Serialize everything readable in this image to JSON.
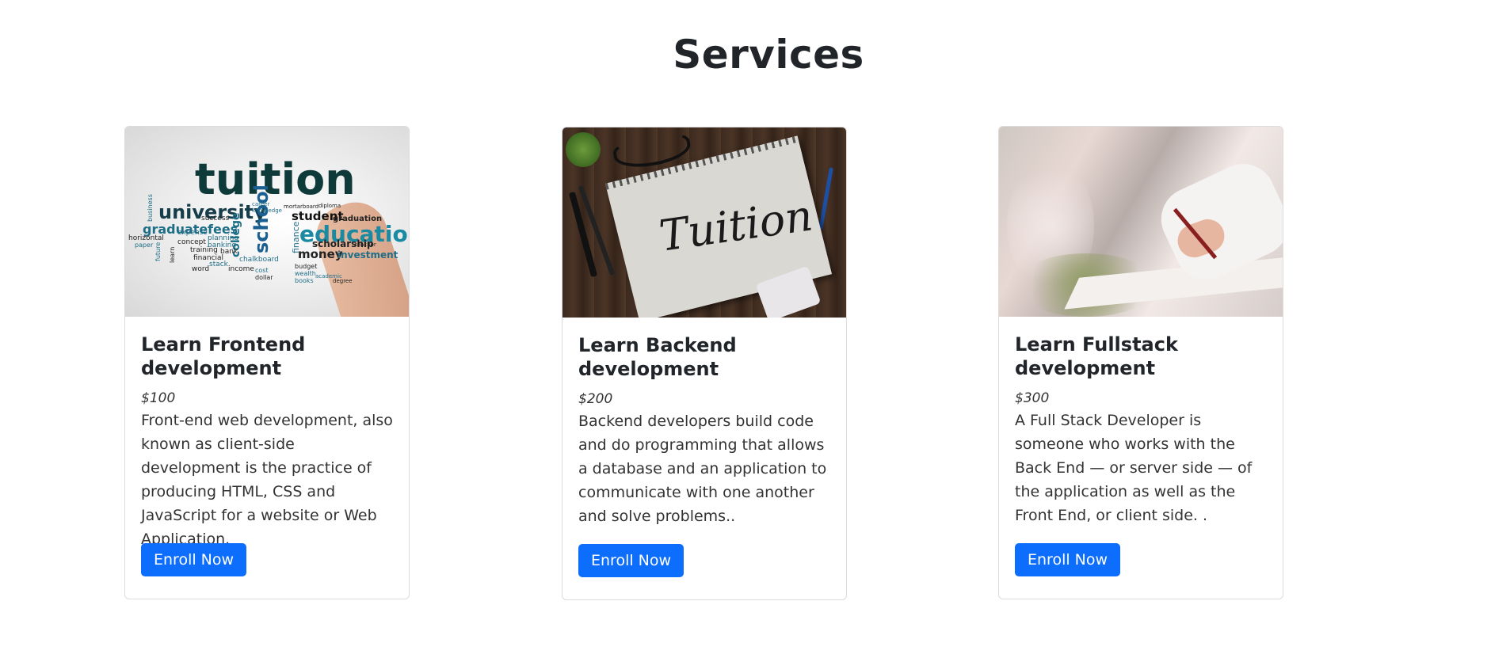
{
  "page": {
    "title": "Services"
  },
  "cards": [
    {
      "image_name": "word-cloud",
      "title": "Learn Frontend development",
      "price": "$100",
      "description": "Front-end web development, also known as client-side development is the practice of producing HTML, CSS and JavaScript for a website or Web Application.",
      "button_label": "Enroll Now"
    },
    {
      "image_name": "notebook",
      "title": "Learn Backend development",
      "price": "$200",
      "description": "Backend developers build code and do programming that allows a database and an application to communicate with one another and solve problems..",
      "button_label": "Enroll Now"
    },
    {
      "image_name": "exam-writing",
      "title": "Learn Fullstack development",
      "price": "$300",
      "description": "A Full Stack Developer is someone who works with the Back End — or server side — of the application as well as the Front End, or client side. .",
      "button_label": "Enroll Now"
    }
  ],
  "word_cloud": {
    "words": [
      "tuition",
      "university",
      "graduate",
      "fees",
      "student",
      "education",
      "school",
      "college",
      "money",
      "scholarship",
      "investment",
      "finance",
      "success",
      "horizontal",
      "expense",
      "planning",
      "concept",
      "banking",
      "training",
      "bank",
      "financial",
      "stack",
      "income",
      "chalkboard",
      "word",
      "cost",
      "dollar",
      "wealth",
      "books",
      "budget",
      "career",
      "knowledge",
      "diploma",
      "mortarboard",
      "graduation",
      "business",
      "paper",
      "future",
      "learn",
      "teacher",
      "academic",
      "degree"
    ]
  },
  "notebook": {
    "text": "Tuition"
  },
  "colors": {
    "button": "#0d6efd",
    "title": "#212529"
  }
}
